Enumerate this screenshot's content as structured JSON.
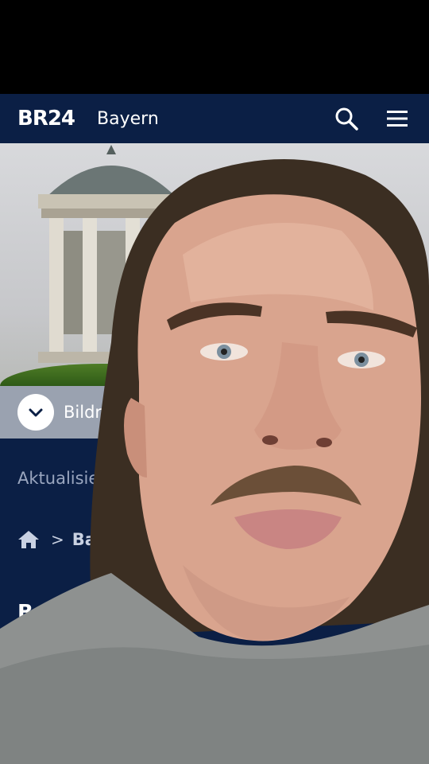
{
  "header": {
    "logo": "BR24",
    "region": "Bayern"
  },
  "hero": {
    "caption": "Bildrech"
  },
  "article": {
    "updated": "Aktualisiert am",
    "breadcrumb": {
      "current": "Bayern h"
    },
    "heading": "B"
  },
  "colors": {
    "nav_bg": "#0b1f45",
    "caption_bg": "#9aa2b0",
    "accent_white": "#ffffff"
  },
  "icons": [
    "search-icon",
    "menu-icon",
    "chevron-down-icon",
    "home-icon"
  ]
}
